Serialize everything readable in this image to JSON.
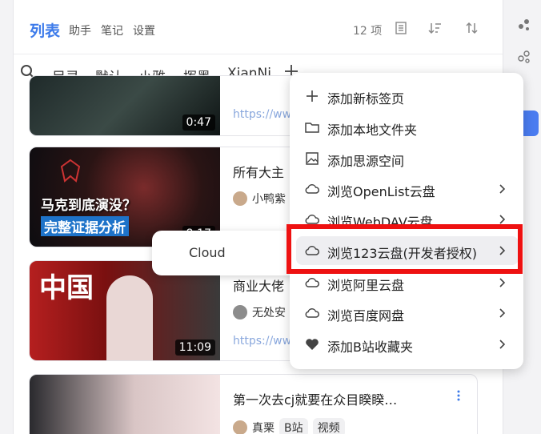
{
  "header": {
    "title": "列表",
    "links": [
      "助手",
      "笔记",
      "设置"
    ],
    "count": "12 项"
  },
  "tabs": [
    "目录",
    "默认",
    "小雅",
    "挥墨",
    "XianNi"
  ],
  "cards": [
    {
      "duration": "0:47",
      "url": "https://www",
      "title": "",
      "author": ""
    },
    {
      "duration": "8:17",
      "title": "所有大主",
      "author": "小鸭紫",
      "thumb_text1": "马克到底演没？",
      "thumb_text2": "完整证据分析"
    },
    {
      "duration": "11:09",
      "title": "商业大佬",
      "author": "无处安",
      "url": "https://www",
      "thumb_text1": "中国"
    },
    {
      "duration": "",
      "title": "第一次去cj就要在众目睽睽…",
      "author": "真栗",
      "tags": [
        "B站",
        "视频"
      ]
    }
  ],
  "submenu": {
    "label": "Cloud"
  },
  "menu": {
    "items": [
      {
        "label": "添加新标签页",
        "icon": "plus-icon",
        "chevron": false
      },
      {
        "label": "添加本地文件夹",
        "icon": "folder-icon",
        "chevron": false
      },
      {
        "label": "添加思源空间",
        "icon": "image-icon",
        "chevron": false
      },
      {
        "label": "浏览OpenList云盘",
        "icon": "cloud-icon",
        "chevron": true
      },
      {
        "label": "浏览WebDAV云盘",
        "icon": "cloud-icon",
        "chevron": true
      },
      {
        "label": "浏览123云盘(开发者授权)",
        "icon": "cloud-icon",
        "chevron": true
      },
      {
        "label": "浏览阿里云盘",
        "icon": "cloud-icon",
        "chevron": true
      },
      {
        "label": "浏览百度网盘",
        "icon": "cloud-icon",
        "chevron": true
      },
      {
        "label": "添加B站收藏夹",
        "icon": "heart-icon",
        "chevron": true
      }
    ]
  },
  "colors": {
    "accent": "#3d7bea",
    "highlight": "#ee1111"
  }
}
